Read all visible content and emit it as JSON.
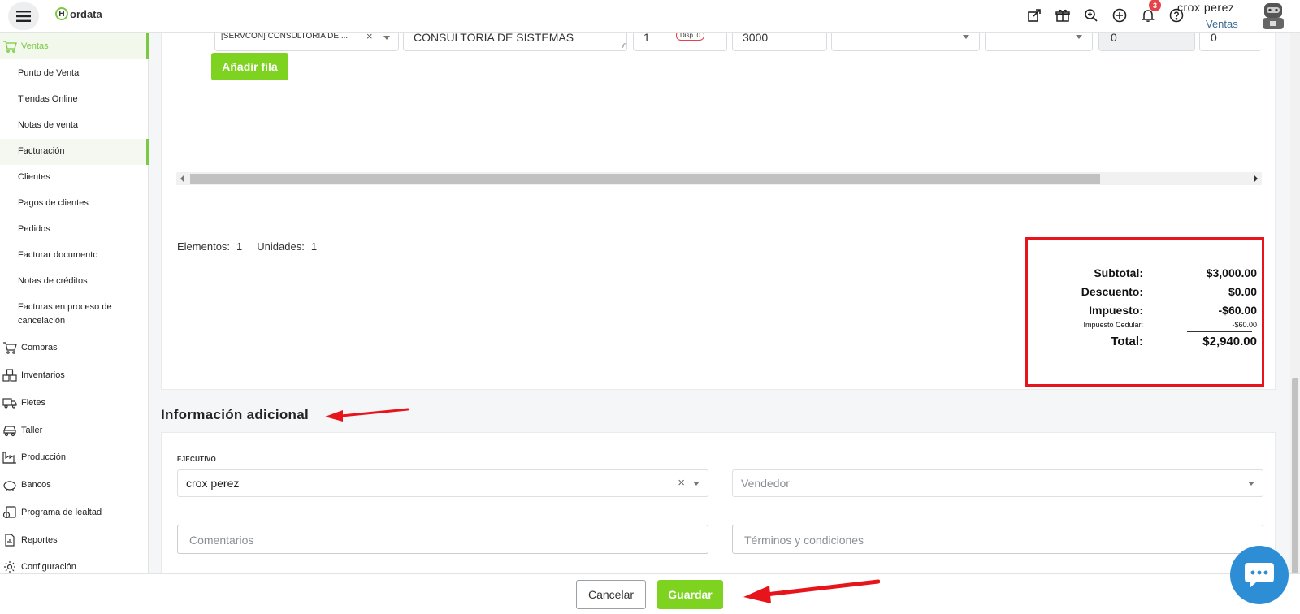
{
  "topbar": {
    "logo_text": "ordata",
    "logo_letter": "H",
    "notification_count": "3",
    "user_name": "crox perez",
    "user_role": "Ventas"
  },
  "sidebar": {
    "ventas_label": "Ventas",
    "ventas_items": [
      "Punto de Venta",
      "Tiendas Online",
      "Notas de venta",
      "Facturación",
      "Clientes",
      "Pagos de clientes",
      "Pedidos",
      "Facturar documento",
      "Notas de créditos",
      "Facturas en proceso de",
      "cancelación"
    ],
    "sections": [
      "Compras",
      "Inventarios",
      "Fletes",
      "Taller",
      "Producción",
      "Bancos",
      "Programa de lealtad",
      "Reportes",
      "Configuración"
    ]
  },
  "item_row": {
    "product": "[SERVCON] CONSULTORIA DE ...",
    "description": "CONSULTORIA DE SISTEMAS",
    "quantity": "1",
    "stock_badge": "Disp. 0",
    "price": "3000",
    "col_a": "0",
    "col_b": "0"
  },
  "add_row_label": "Añadir fila",
  "counts": {
    "elements_label": "Elementos:",
    "elements_value": "1",
    "units_label": "Unidades:",
    "units_value": "1"
  },
  "totals": {
    "subtotal_label": "Subtotal:",
    "subtotal_value": "$3,000.00",
    "discount_label": "Descuento:",
    "discount_value": "$0.00",
    "tax_label": "Impuesto:",
    "tax_value": "-$60.00",
    "cedular_label": "Impuesto Cedular:",
    "cedular_value": "-$60.00",
    "total_label": "Total:",
    "total_value": "$2,940.00"
  },
  "info": {
    "title": "Información adicional",
    "executive_label": "EJECUTIVO",
    "executive_value": "crox perez",
    "seller_placeholder": "Vendedor",
    "comments_placeholder": "Comentarios",
    "terms_placeholder": "Términos y condiciones"
  },
  "footer": {
    "cancel_label": "Cancelar",
    "save_label": "Guardar"
  },
  "colors": {
    "accent_green": "#7ed321",
    "highlight_red": "#e8141b",
    "chat_blue": "#2d8ed6"
  }
}
